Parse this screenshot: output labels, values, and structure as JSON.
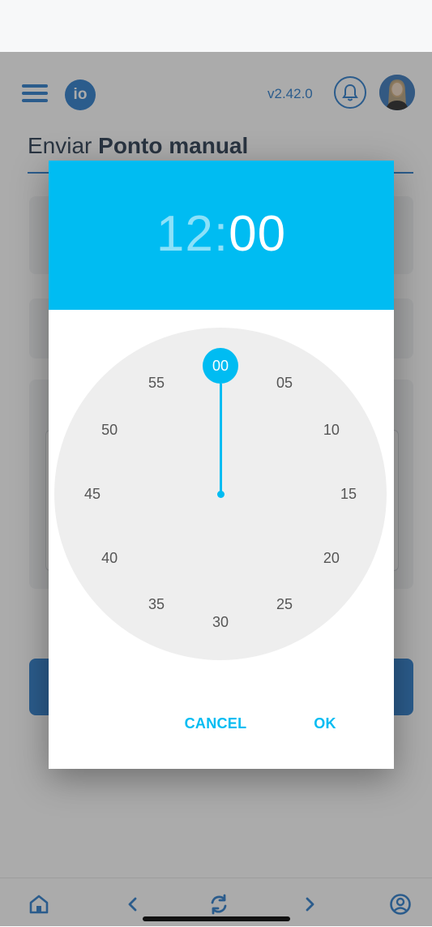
{
  "header": {
    "logo_text": "io",
    "version": "v2.42.0"
  },
  "page": {
    "title_light": "Enviar",
    "title_bold": "Ponto manual"
  },
  "time_picker": {
    "hours": "12",
    "separator": ":",
    "minutes": "00",
    "selected_minute": "00",
    "minute_marks": [
      "00",
      "05",
      "10",
      "15",
      "20",
      "25",
      "30",
      "35",
      "40",
      "45",
      "50",
      "55"
    ],
    "cancel_label": "CANCEL",
    "ok_label": "OK",
    "accent_color": "#00bcf2"
  },
  "bottom_nav": {
    "icons": [
      "home-icon",
      "chevron-left-icon",
      "refresh-icon",
      "chevron-right-icon",
      "user-circle-icon"
    ]
  },
  "colors": {
    "brand": "#1f74c9",
    "overlay": "rgba(60,60,60,0.43)"
  }
}
